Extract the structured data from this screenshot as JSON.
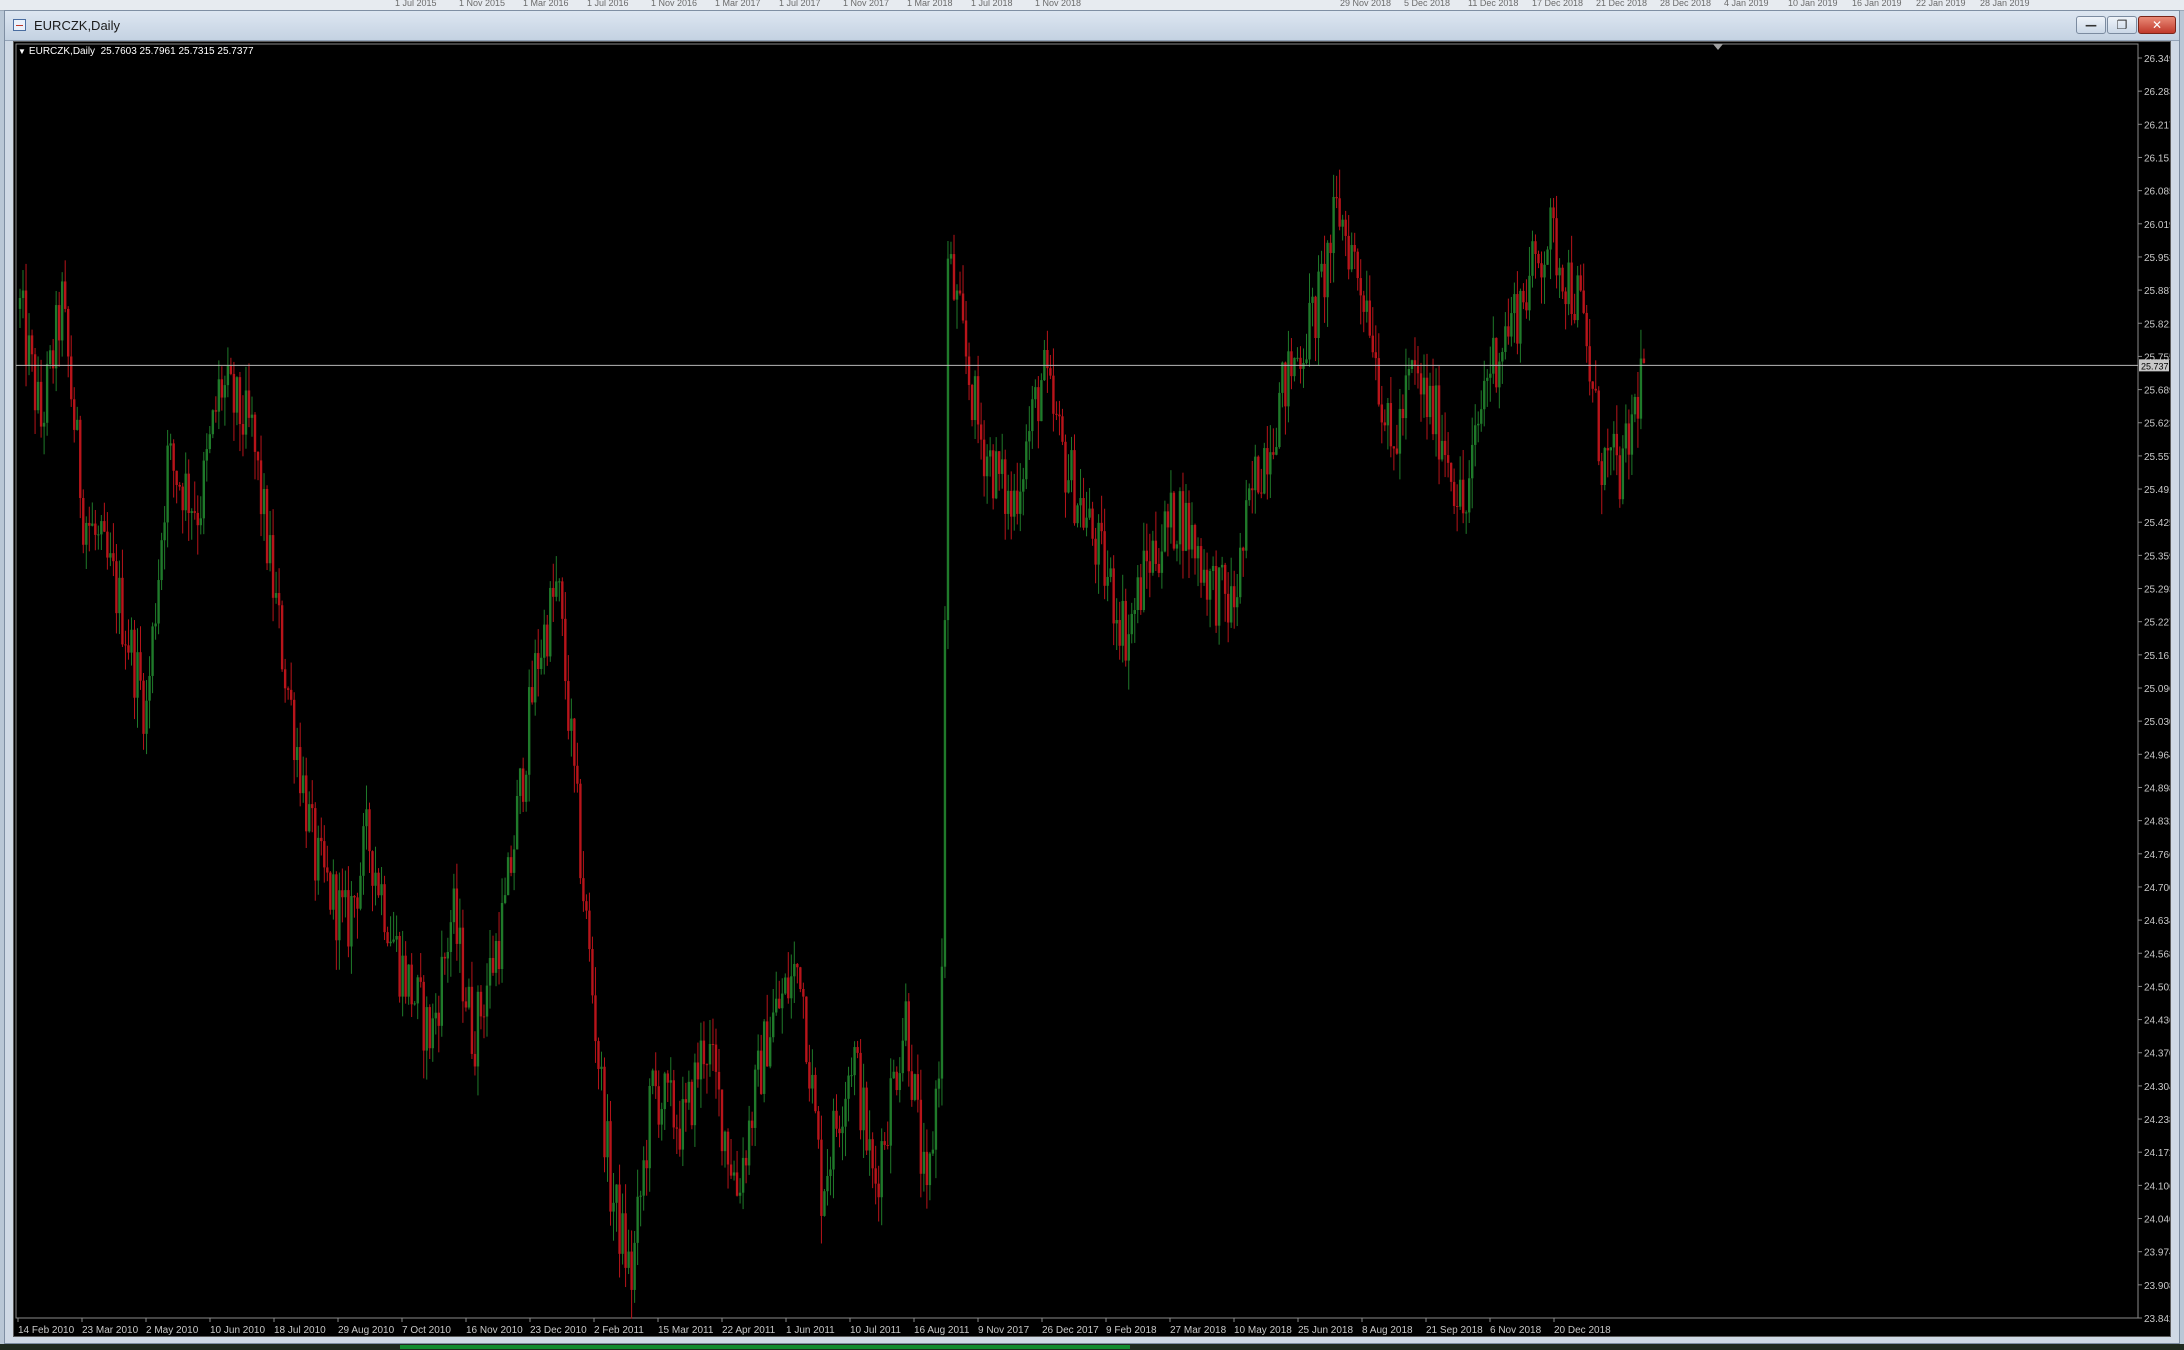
{
  "background_axis_labels": [
    "1 Jul 2015",
    "1 Nov 2015",
    "1 Mar 2016",
    "1 Jul 2016",
    "1 Nov 2016",
    "1 Mar 2017",
    "1 Jul 2017",
    "1 Nov 2017",
    "1 Mar 2018",
    "1 Jul 2018",
    "1 Nov 2018",
    "29 Nov 2018",
    "5 Dec 2018",
    "11 Dec 2018",
    "17 Dec 2018",
    "21 Dec 2018",
    "28 Dec 2018",
    "4 Jan 2019",
    "10 Jan 2019",
    "16 Jan 2019",
    "22 Jan 2019",
    "28 Jan 2019"
  ],
  "window": {
    "title": "EURCZK,Daily",
    "buttons": {
      "minimize": "—",
      "restore": "❐",
      "close": "✕"
    }
  },
  "symbol_info": {
    "symbol": "EURCZK,Daily",
    "ohlc": "25.7603 25.7961 25.7315 25.7377"
  },
  "colors": {
    "background": "#000000",
    "bull": "#1f7a2a",
    "bear": "#b8141a",
    "grid_text": "#c8c8c8",
    "price_line": "#b8b8b8"
  },
  "chart_data": {
    "type": "candlestick",
    "title": "EURCZK,Daily",
    "xlabel": "",
    "ylabel": "",
    "ylim": [
      23.8425,
      26.377
    ],
    "grid": false,
    "y_ticks": [
      "26.3490",
      "26.2830",
      "26.2170",
      "26.1510",
      "26.0850",
      "26.0190",
      "25.9530",
      "25.8870",
      "25.8210",
      "25.7550",
      "25.6890",
      "25.6230",
      "25.5570",
      "25.4910",
      "25.4250",
      "25.3590",
      "25.2930",
      "25.2270",
      "25.1610",
      "25.0965",
      "25.0305",
      "24.9645",
      "24.8985",
      "24.8325",
      "24.7665",
      "24.7005",
      "24.6345",
      "24.5685",
      "24.5025",
      "24.4365",
      "24.3705",
      "24.3045",
      "24.2385",
      "24.1725",
      "24.1065",
      "24.0405",
      "23.9745",
      "23.9085",
      "23.8425"
    ],
    "x_tick_labels": [
      "14 Feb 2010",
      "23 Mar 2010",
      "2 May 2010",
      "10 Jun 2010",
      "18 Jul 2010",
      "29 Aug 2010",
      "7 Oct 2010",
      "16 Nov 2010",
      "23 Dec 2010",
      "2 Feb 2011",
      "15 Mar 2011",
      "22 Apr 2011",
      "1 Jun 2011",
      "10 Jul 2011",
      "16 Aug 2011",
      "9 Nov 2017",
      "26 Dec 2017",
      "9 Feb 2018",
      "27 Mar 2018",
      "10 May 2018",
      "25 Jun 2018",
      "8 Aug 2018",
      "21 Sep 2018",
      "6 Nov 2018",
      "20 Dec 2018"
    ],
    "current_price_label": "25.7377",
    "current_price": 25.7377,
    "close_path": [
      {
        "x": 0,
        "y": 25.85
      },
      {
        "x": 0.01,
        "y": 25.62
      },
      {
        "x": 0.02,
        "y": 25.86
      },
      {
        "x": 0.03,
        "y": 25.45
      },
      {
        "x": 0.045,
        "y": 25.3
      },
      {
        "x": 0.06,
        "y": 25.05
      },
      {
        "x": 0.07,
        "y": 25.55
      },
      {
        "x": 0.085,
        "y": 25.45
      },
      {
        "x": 0.095,
        "y": 25.7
      },
      {
        "x": 0.11,
        "y": 25.6
      },
      {
        "x": 0.125,
        "y": 25.15
      },
      {
        "x": 0.14,
        "y": 24.75
      },
      {
        "x": 0.155,
        "y": 24.62
      },
      {
        "x": 0.165,
        "y": 24.8
      },
      {
        "x": 0.18,
        "y": 24.55
      },
      {
        "x": 0.195,
        "y": 24.4
      },
      {
        "x": 0.205,
        "y": 24.65
      },
      {
        "x": 0.215,
        "y": 24.4
      },
      {
        "x": 0.23,
        "y": 24.65
      },
      {
        "x": 0.245,
        "y": 25.15
      },
      {
        "x": 0.255,
        "y": 25.3
      },
      {
        "x": 0.268,
        "y": 24.65
      },
      {
        "x": 0.28,
        "y": 24.1
      },
      {
        "x": 0.29,
        "y": 23.92
      },
      {
        "x": 0.3,
        "y": 24.3
      },
      {
        "x": 0.315,
        "y": 24.22
      },
      {
        "x": 0.325,
        "y": 24.4
      },
      {
        "x": 0.34,
        "y": 24.1
      },
      {
        "x": 0.355,
        "y": 24.42
      },
      {
        "x": 0.37,
        "y": 24.55
      },
      {
        "x": 0.38,
        "y": 24.1
      },
      {
        "x": 0.395,
        "y": 24.38
      },
      {
        "x": 0.405,
        "y": 24.1
      },
      {
        "x": 0.42,
        "y": 24.45
      },
      {
        "x": 0.43,
        "y": 24.05
      },
      {
        "x": 0.437,
        "y": 24.44
      },
      {
        "x": 0.44,
        "y": 25.95
      },
      {
        "x": 0.455,
        "y": 25.6
      },
      {
        "x": 0.47,
        "y": 25.45
      },
      {
        "x": 0.485,
        "y": 25.72
      },
      {
        "x": 0.495,
        "y": 25.55
      },
      {
        "x": 0.51,
        "y": 25.38
      },
      {
        "x": 0.525,
        "y": 25.2
      },
      {
        "x": 0.535,
        "y": 25.35
      },
      {
        "x": 0.55,
        "y": 25.45
      },
      {
        "x": 0.565,
        "y": 25.3
      },
      {
        "x": 0.575,
        "y": 25.25
      },
      {
        "x": 0.585,
        "y": 25.5
      },
      {
        "x": 0.6,
        "y": 25.7
      },
      {
        "x": 0.615,
        "y": 25.85
      },
      {
        "x": 0.625,
        "y": 26.05
      },
      {
        "x": 0.64,
        "y": 25.85
      },
      {
        "x": 0.65,
        "y": 25.55
      },
      {
        "x": 0.66,
        "y": 25.72
      },
      {
        "x": 0.675,
        "y": 25.6
      },
      {
        "x": 0.685,
        "y": 25.43
      },
      {
        "x": 0.695,
        "y": 25.72
      },
      {
        "x": 0.71,
        "y": 25.85
      },
      {
        "x": 0.725,
        "y": 26.0
      },
      {
        "x": 0.74,
        "y": 25.85
      },
      {
        "x": 0.75,
        "y": 25.55
      },
      {
        "x": 0.76,
        "y": 25.52
      },
      {
        "x": 0.77,
        "y": 25.75
      }
    ]
  }
}
